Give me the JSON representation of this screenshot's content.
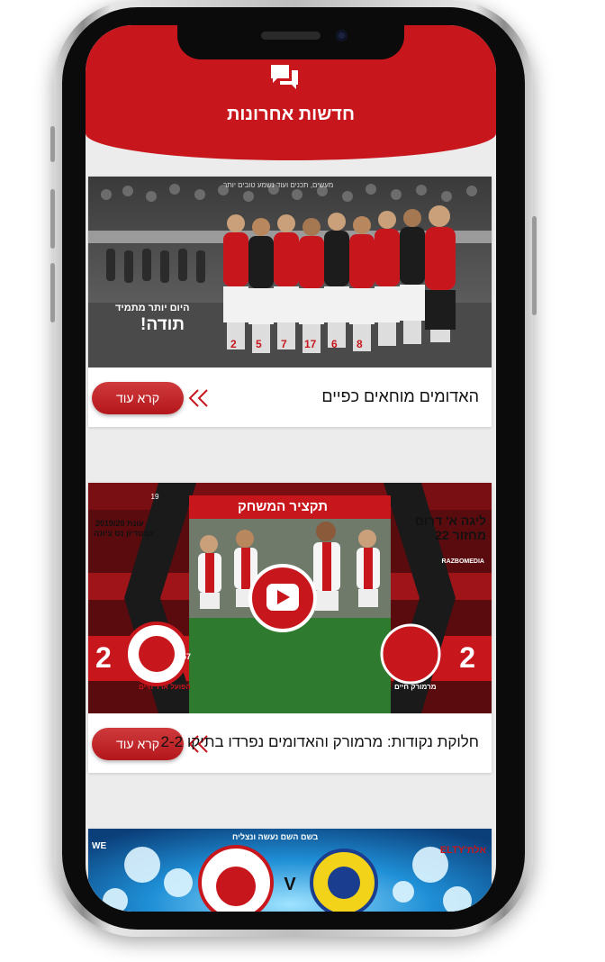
{
  "header": {
    "title": "חדשות אחרונות",
    "icon": "chat-bubbles-icon"
  },
  "posts": [
    {
      "title": "האדומים מוחאים כפיים",
      "read_more": "קרא עוד",
      "image": {
        "banner_small": "מעשים, תכנים ועוד נשמע טובים יותר",
        "slogan_line1": "היום יותר מתמיד",
        "slogan_line2": "תודה!",
        "jersey_numbers": [
          "2",
          "5",
          "7",
          "17",
          "6",
          "8"
        ]
      }
    },
    {
      "title": "חלוקת נקודות: מרמורק והאדומים נפרדו בתיקו 2-2",
      "read_more": "קרא עוד",
      "image": {
        "header": "תקציר המשחק",
        "league_line1": "ליגה א' דרום",
        "league_line2": "מחזור 22",
        "season_line1": "עונת 2019/20",
        "season_line2": "אצטדיון נס ציונה",
        "home_score": "2",
        "away_score": "2",
        "home_team": "הפועל ארד חיים",
        "away_team": "מרמורק חיים",
        "watermark": "RAZBOMEDIA",
        "crest_year_left": "19",
        "crest_year_right": "57"
      }
    },
    {
      "image": {
        "caption": "בשם השם נעשה ונצליח",
        "sponsor": "אלת'ELTY",
        "vs": "V",
        "side_text": "WE"
      }
    }
  ],
  "colors": {
    "primary": "#c8161d",
    "button": "#c0272b"
  }
}
